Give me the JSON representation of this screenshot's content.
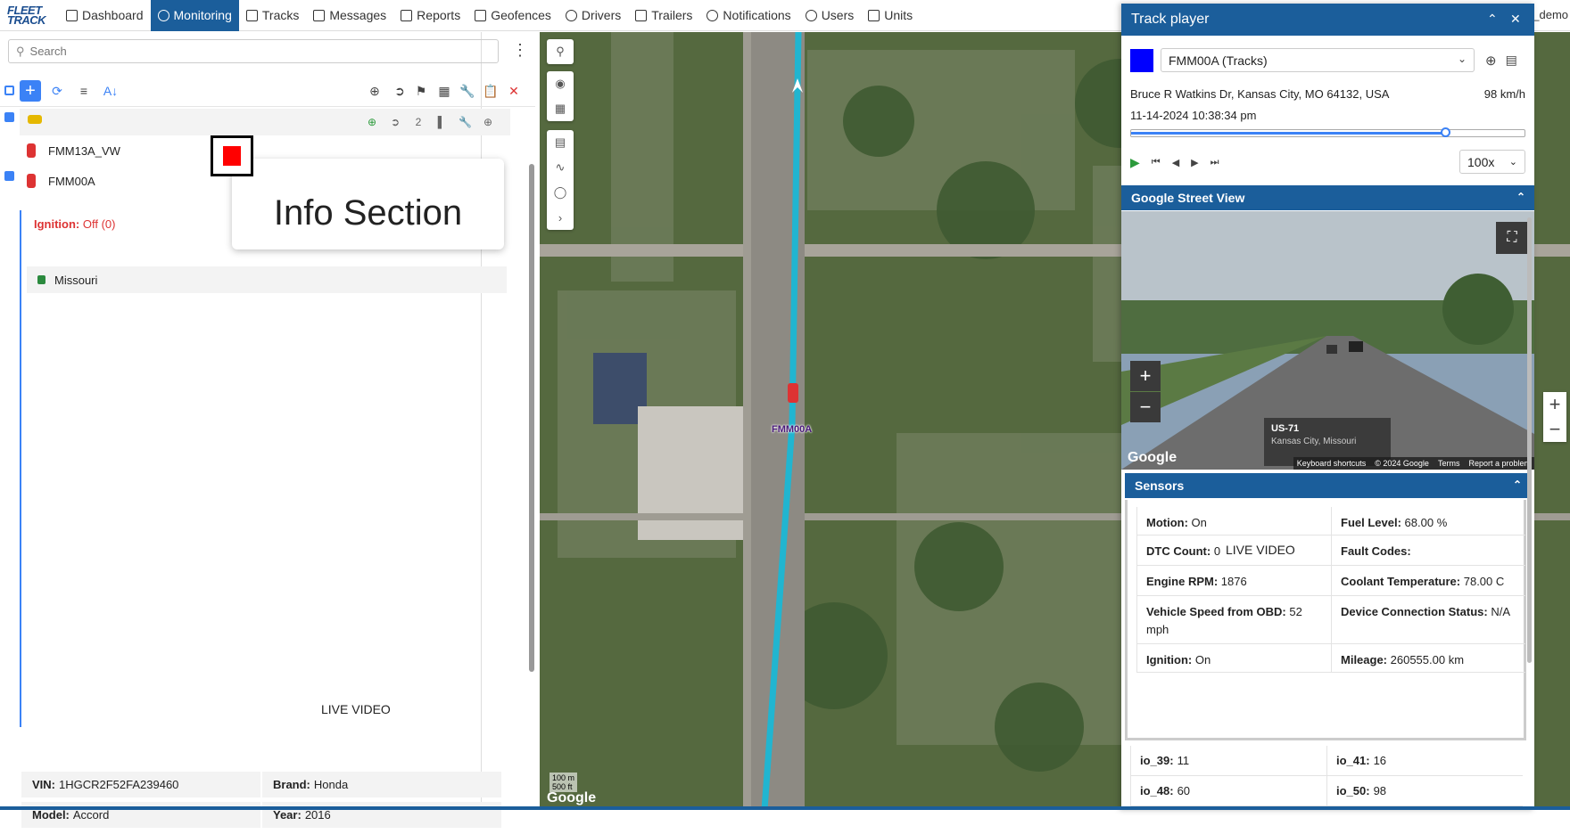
{
  "nav": {
    "logo": "FLEET TRACK",
    "items": [
      {
        "label": "Dashboard",
        "icon": "bar-chart-icon"
      },
      {
        "label": "Monitoring",
        "icon": "globe-icon",
        "active": true
      },
      {
        "label": "Tracks",
        "icon": "flag-icon"
      },
      {
        "label": "Messages",
        "icon": "document-icon"
      },
      {
        "label": "Reports",
        "icon": "report-icon"
      },
      {
        "label": "Geofences",
        "icon": "polygon-icon"
      },
      {
        "label": "Drivers",
        "icon": "steering-wheel-icon"
      },
      {
        "label": "Trailers",
        "icon": "trailer-icon"
      },
      {
        "label": "Notifications",
        "icon": "alarm-icon"
      },
      {
        "label": "Users",
        "icon": "user-icon"
      },
      {
        "label": "Units",
        "icon": "bus-icon"
      }
    ],
    "user": "_demo"
  },
  "left": {
    "search_placeholder": "Search",
    "units": [
      {
        "name": "FMM13A_VW"
      },
      {
        "name": "FMM00A"
      }
    ],
    "ignition_label": "Ignition:",
    "ignition_value": "Off (0)",
    "geofence": "Missouri",
    "live_video": "LIVE VIDEO",
    "info": {
      "vin_label": "VIN:",
      "vin": "1HGCR2F52FA239460",
      "brand_label": "Brand:",
      "brand": "Honda",
      "model_label": "Model:",
      "model": "Accord",
      "year_label": "Year:",
      "year": "2016"
    }
  },
  "overlay": {
    "info_section": "Info Section"
  },
  "map": {
    "vehicle_label": "FMM00A",
    "scale_top": "100 m",
    "scale_bottom": "500 ft",
    "google": "Google"
  },
  "track_player": {
    "title": "Track player",
    "unit_select": "FMM00A (Tracks)",
    "unit_color": "#0000ff",
    "address": "Bruce R Watkins Dr, Kansas City, MO 64132, USA",
    "speed": "98 km/h",
    "timestamp": "11-14-2024 10:38:34 pm",
    "progress": 0.8,
    "playback_speed": "100x",
    "street_view": {
      "title": "Google Street View",
      "road": "US-71",
      "city": "Kansas City, Missouri",
      "footer": [
        "Keyboard shortcuts",
        "© 2024 Google",
        "Terms",
        "Report a problem"
      ],
      "google": "Google"
    },
    "sensors": {
      "title": "Sensors",
      "live_video": "LIVE VIDEO",
      "items": [
        {
          "label": "Motion:",
          "value": "On"
        },
        {
          "label": "Fuel Level:",
          "value": "68.00 %"
        },
        {
          "label": "DTC Count:",
          "value": "0"
        },
        {
          "label": "Fault Codes:",
          "value": ""
        },
        {
          "label": "Engine RPM:",
          "value": "1876"
        },
        {
          "label": "Coolant Temperature:",
          "value": "78.00 C"
        },
        {
          "label": "Vehicle Speed from OBD:",
          "value": "52 mph"
        },
        {
          "label": "Device Connection Status:",
          "value": "N/A"
        },
        {
          "label": "Ignition:",
          "value": "On"
        },
        {
          "label": "Mileage:",
          "value": "260555.00 km"
        }
      ]
    },
    "io": [
      {
        "label": "io_39:",
        "value": "11"
      },
      {
        "label": "io_41:",
        "value": "16"
      },
      {
        "label": "io_48:",
        "value": "60"
      },
      {
        "label": "io_50:",
        "value": "98"
      }
    ]
  },
  "colors": {
    "primary": "#1b5e9b",
    "accent": "#3b82f6",
    "track_line": "#21b5d0",
    "danger": "#d33333"
  }
}
